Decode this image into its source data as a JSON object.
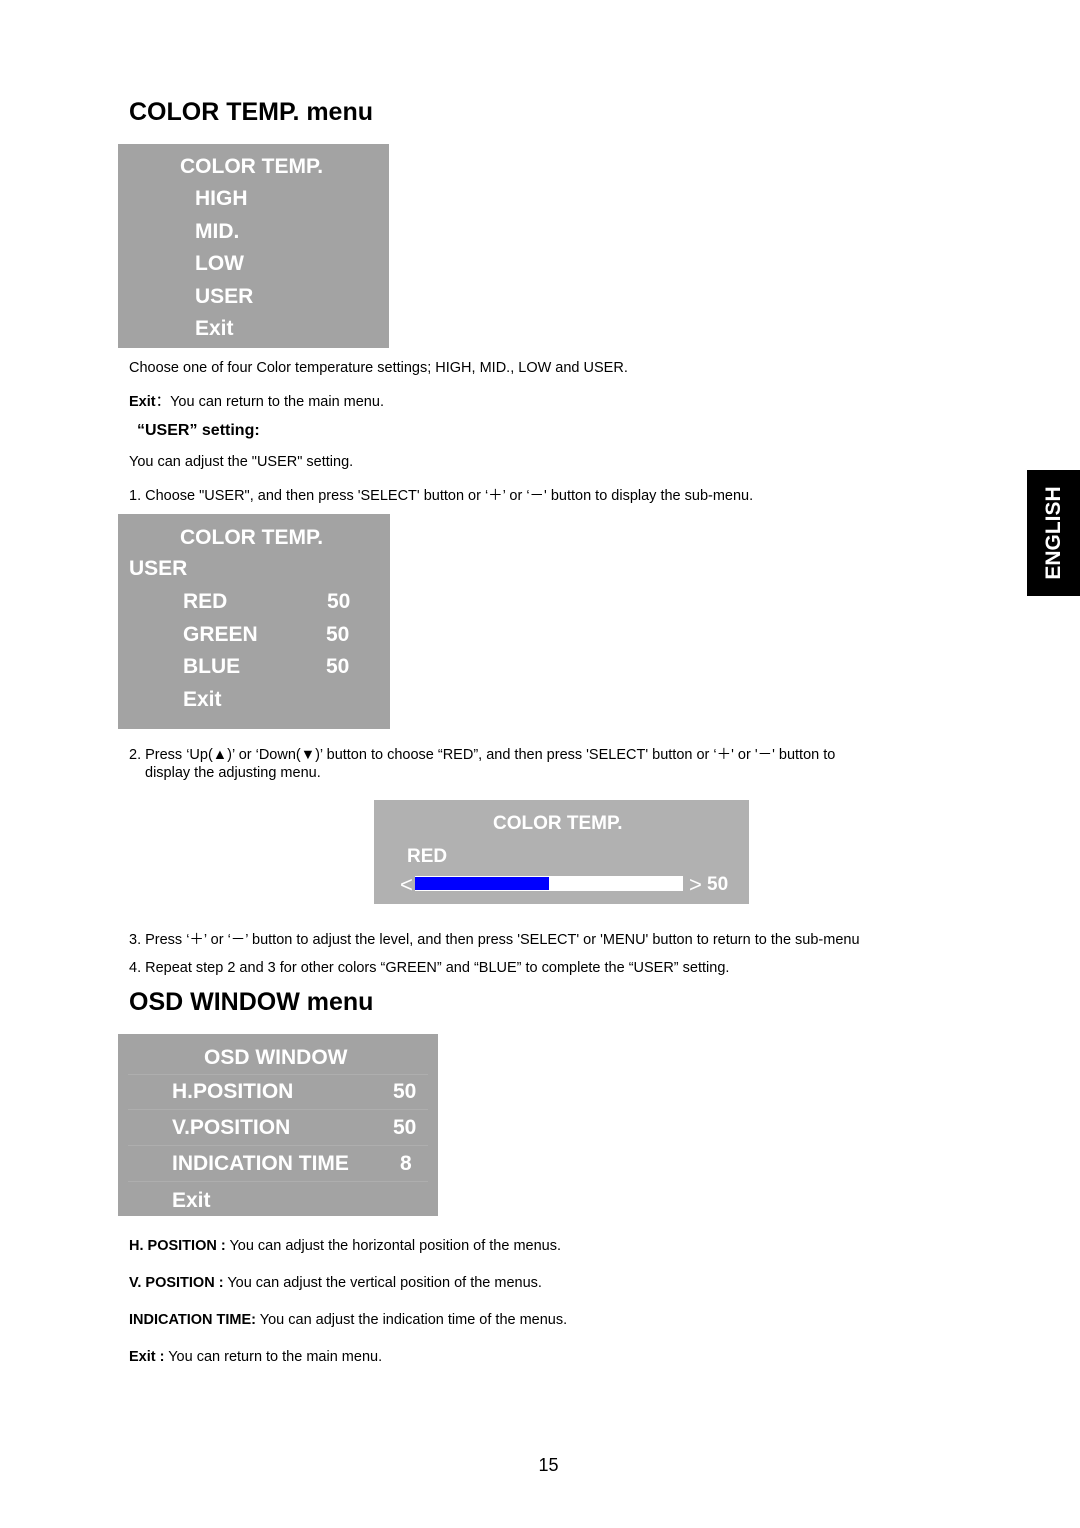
{
  "color_temp_section": {
    "title": "COLOR TEMP. menu",
    "menu": {
      "header": "COLOR TEMP.",
      "items": [
        "HIGH",
        "MID.",
        "LOW",
        "USER",
        "Exit"
      ]
    },
    "description": "Choose one of four Color temperature settings; HIGH, MID., LOW and USER.",
    "exit_label": "Exit",
    "exit_text": "：You can return to the main menu.",
    "user_heading": "“USER” setting:",
    "user_intro": "You can adjust the \"USER\" setting.",
    "step1": "1. Choose \"USER\", and then press 'SELECT' button or ‘＋’ or ‘－' button to display the sub-menu.",
    "user_menu": {
      "header": "COLOR TEMP.",
      "subheader": "USER",
      "rows": [
        {
          "label": "RED",
          "value": "50"
        },
        {
          "label": "GREEN",
          "value": "50"
        },
        {
          "label": "BLUE",
          "value": "50"
        }
      ],
      "exit": "Exit"
    },
    "step2_line1": "2. Press ‘Up(▲)’ or ‘Down(▼)’ button to choose “RED”, and then press 'SELECT' button or ‘＋' or '－' button to",
    "step2_line2": "display the adjusting menu.",
    "adjust_menu": {
      "header": "COLOR TEMP.",
      "label": "RED",
      "left_arrow": "<",
      "right_arrow": ">",
      "value": "50",
      "level_percent": 50,
      "bar_color": "#0000ff"
    },
    "step3": "3. Press ‘＋’ or ‘－’ button to adjust the level, and then press 'SELECT' or 'MENU' button to return to the sub-menu",
    "step4": "4. Repeat step 2 and 3 for other colors “GREEN” and “BLUE” to complete the “USER” setting."
  },
  "osd_section": {
    "title": "OSD WINDOW menu",
    "menu": {
      "header": "OSD WINDOW",
      "rows": [
        {
          "label": "H.POSITION",
          "value": "50"
        },
        {
          "label": "V.POSITION",
          "value": "50"
        },
        {
          "label": "INDICATION TIME",
          "value": "8"
        }
      ],
      "exit": "Exit"
    },
    "descriptions": [
      {
        "label": "H. POSITION :",
        "text": " You can adjust the horizontal position of the menus."
      },
      {
        "label": "V. POSITION :",
        "text": " You can adjust the vertical position of the menus."
      },
      {
        "label": "INDICATION TIME:",
        "text": " You can adjust the indication time of the menus."
      },
      {
        "label": "Exit :",
        "text": " You can return to the main menu."
      }
    ]
  },
  "language_tab": "ENGLISH",
  "page_number": "15"
}
